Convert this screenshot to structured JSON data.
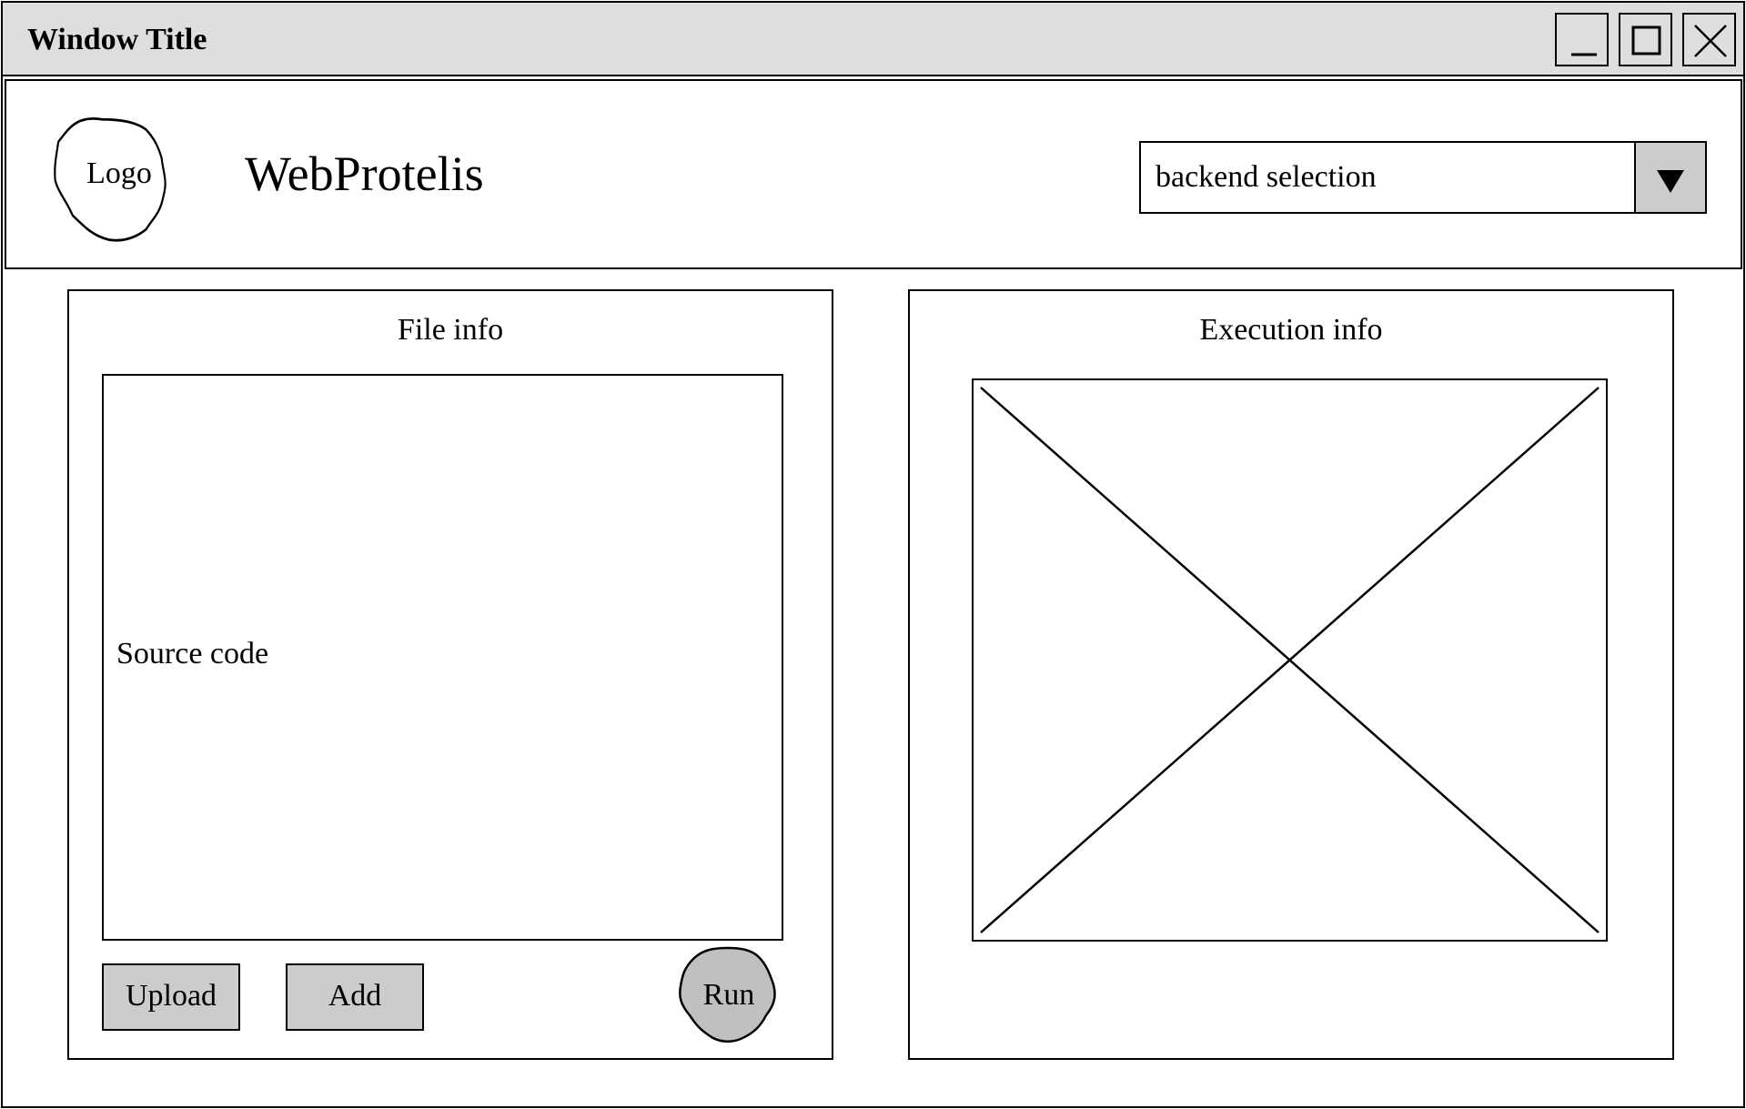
{
  "window": {
    "title": "Window Title",
    "controls": [
      "minimize-icon",
      "maximize-icon",
      "close-icon"
    ]
  },
  "header": {
    "logo_label": "Logo",
    "app_title": "WebProtelis",
    "backend_select": {
      "value": "backend selection",
      "icon": "triangle-down-icon"
    }
  },
  "file_panel": {
    "title": "File info",
    "source_label": "Source code",
    "buttons": {
      "upload": "Upload",
      "add": "Add",
      "run": "Run"
    }
  },
  "execution_panel": {
    "title": "Execution info",
    "image_placeholder": "image-placeholder"
  },
  "colors": {
    "titlebar": "#dedede",
    "button": "#cccccc",
    "run_button": "#c0c0c0",
    "border": "#000000"
  }
}
